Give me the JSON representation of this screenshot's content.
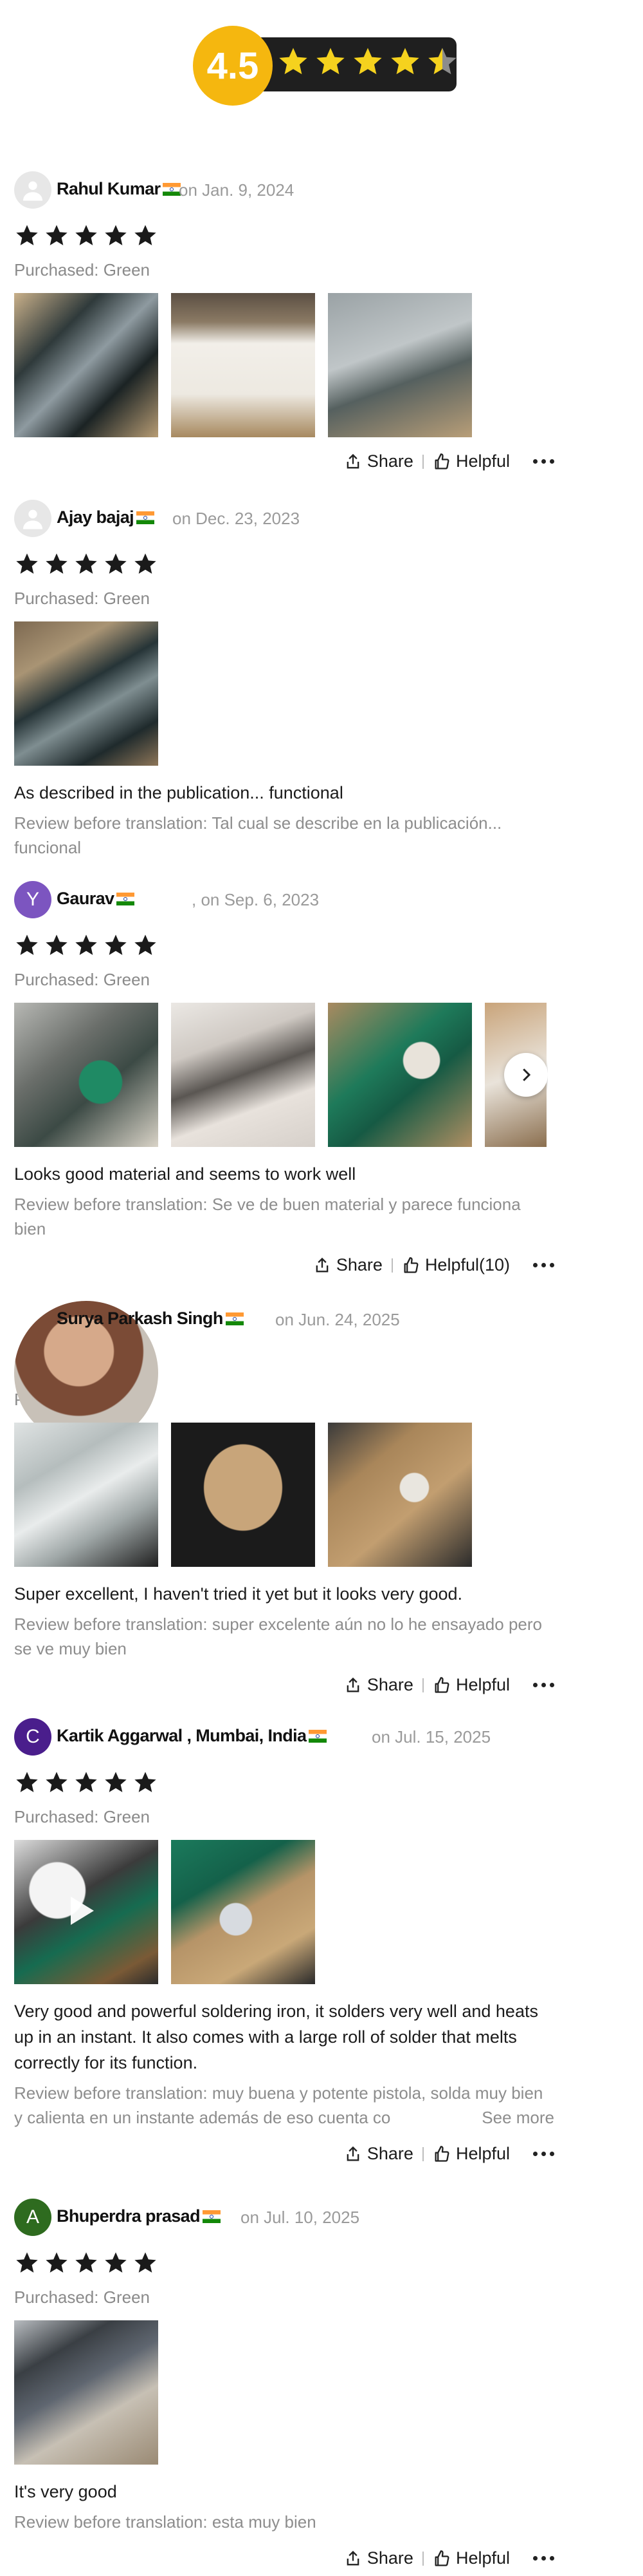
{
  "summary": {
    "rating": "4.5",
    "stars_filled": 4,
    "star_half": true,
    "star_color": "#F5B70F"
  },
  "common": {
    "share_label": "Share",
    "helpful_label": "Helpful"
  },
  "reviews": [
    {
      "name": "Rahul Kumar",
      "avatar": "default-user-icon",
      "date": "on Jan. 9, 2024",
      "stars": 5,
      "purchased": "Purchased: Green",
      "photos": 3,
      "text": "",
      "original": "",
      "helpful": "Helpful"
    },
    {
      "name": "Ajay bajaj",
      "avatar": "default-user-icon",
      "date": "on Dec. 23, 2023",
      "stars": 5,
      "purchased": "Purchased: Green",
      "photos": 1,
      "text": "As described in the publication... functional",
      "original": "Review before translation: Tal cual se describe en la publicación... funcional",
      "helpful": ""
    },
    {
      "name": "Gaurav",
      "avatar_letter": "Y",
      "avatar_color": "#7C55C0",
      "date": ", on Sep. 6, 2023",
      "stars": 5,
      "purchased": "Purchased: Green",
      "photos": 4,
      "text": "Looks good material and seems to work well",
      "original": "Review before translation: Se ve de buen material y parece funciona bien",
      "helpful": "Helpful(10)"
    },
    {
      "name": "Surya Parkash Singh",
      "avatar": "photo-avatar",
      "date": "on Jun. 24, 2025",
      "stars": 5,
      "purchased": "Purchased: Green",
      "photos": 3,
      "text": "Super excellent, I haven't tried it yet but it looks very good.",
      "original": "Review before translation: super excelente aún no lo he ensayado pero se ve muy bien",
      "helpful": "Helpful"
    },
    {
      "name": "Kartik Aggarwal , Mumbai, India",
      "avatar_letter": "C",
      "avatar_color": "#4A1E8C",
      "date": "on Jul. 15, 2025",
      "stars": 5,
      "purchased": "Purchased: Green",
      "photos": 2,
      "text": "Very good and powerful soldering iron, it solders very well and heats up in an instant. It also comes with a large roll of solder that melts correctly for its function.",
      "original": "Review before translation: muy buena y potente pistola, solda muy bien y calienta en un instante además de eso cuenta co",
      "see_more": "See more",
      "helpful": "Helpful"
    },
    {
      "name": "Bhuperdra prasad",
      "avatar_letter": "A",
      "avatar_color": "#2E6B1F",
      "date": "on Jul. 10, 2025",
      "stars": 5,
      "purchased": "Purchased: Green",
      "photos": 1,
      "text": "It's very good",
      "original": "Review before translation: esta muy bien",
      "helpful": "Helpful"
    }
  ]
}
